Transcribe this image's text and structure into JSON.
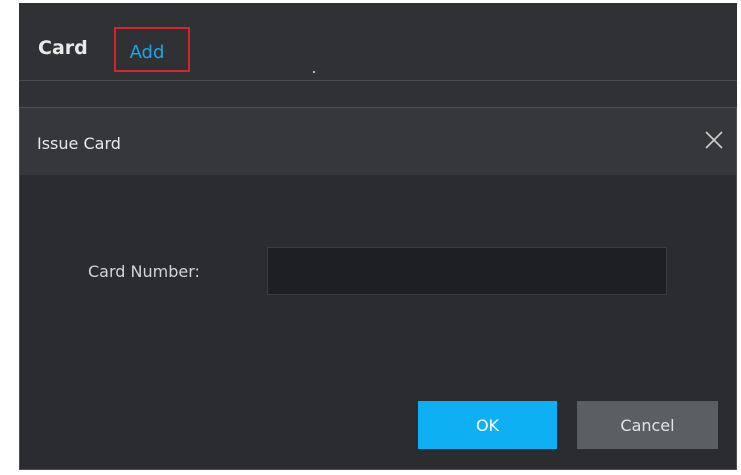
{
  "tabs": {
    "card_label": "Card",
    "add_label": "Add"
  },
  "dialog": {
    "title": "Issue Card",
    "card_number_label": "Card Number:",
    "card_number_value": "",
    "ok_label": "OK",
    "cancel_label": "Cancel"
  },
  "icons": {
    "close": "close-icon"
  },
  "colors": {
    "accent": "#0fb0f3",
    "link": "#1aa7e8",
    "highlight_border": "#d8232a",
    "background": "#2f3134"
  }
}
